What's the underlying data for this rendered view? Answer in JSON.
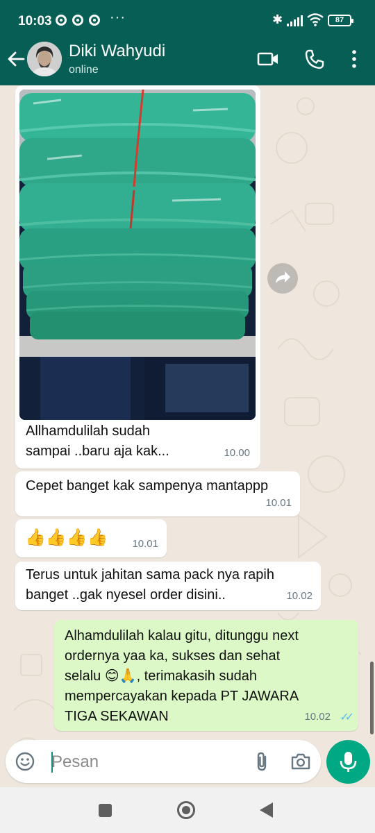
{
  "status_bar": {
    "time": "10:03",
    "overflow": "···",
    "bluetooth_glyph": "✱",
    "battery": "87"
  },
  "header": {
    "contact_name": "Diki Wahyudi",
    "presence": "online",
    "icons": [
      "back-arrow-icon",
      "video-call-icon",
      "voice-call-icon",
      "more-vert-icon"
    ]
  },
  "messages": [
    {
      "direction": "incoming",
      "has_image": true,
      "text": "Allhamdulilah sudah\nsampai ..baru aja kak...",
      "time": "10.00"
    },
    {
      "direction": "incoming",
      "text": "Cepet banget kak sampenya mantappp",
      "time": "10.01"
    },
    {
      "direction": "incoming",
      "text": "👍👍👍👍",
      "time": "10.01"
    },
    {
      "direction": "incoming",
      "text": "Terus untuk jahitan sama pack nya rapih\nbanget ..gak nyesel order disini..",
      "time": "10.02"
    },
    {
      "direction": "outgoing",
      "text": "Alhamdulilah kalau gitu, ditunggu next\nordernya yaa ka, sukses dan sehat\nselalu 😊🙏, terimakasih sudah\nmempercayakan kepada PT JAWARA\nTIGA SEKAWAN",
      "time": "10.02",
      "ticks": "✓✓",
      "read": true
    }
  ],
  "composer": {
    "placeholder": "Pesan",
    "icons": [
      "emoji-icon",
      "attach-icon",
      "camera-icon",
      "mic-icon"
    ]
  },
  "colors": {
    "header": "#075e54",
    "outgoing_bubble": "#dcf8c6",
    "incoming_bubble": "#ffffff",
    "chat_background": "#efe7de",
    "accent": "#00a884",
    "read_ticks": "#53bdeb"
  }
}
